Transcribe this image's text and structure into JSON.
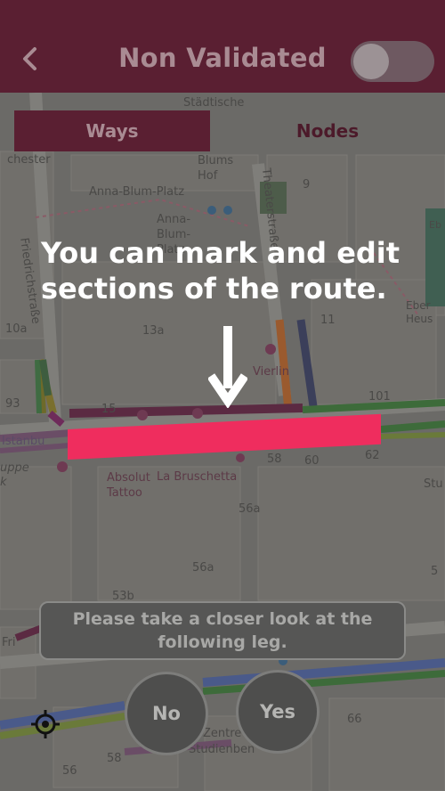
{
  "header": {
    "back_icon": "chevron-left-icon",
    "title": "Non Validated",
    "toggle_on": false
  },
  "tabs": [
    {
      "label": "Ways",
      "active": true
    },
    {
      "label": "Nodes",
      "active": false
    }
  ],
  "map": {
    "labels": {
      "stadtische": "Städtische",
      "chester": "chester",
      "blums_hof": "Blums\nHof",
      "n9": "9",
      "theaterstrasse": "Theaterstraße",
      "anna_blum_platz": "Anna-Blum-Platz",
      "anna_blum": "Anna-\nBlum-\nPlatz",
      "eb": "Eb",
      "friedrichstrasse": "Friedrichstraße",
      "n10a": "10a",
      "n13a": "13a",
      "n11": "11",
      "vierlin": "Vierlin",
      "n101": "101",
      "n93": "93",
      "n15": "15",
      "istanbul": "Istanbu",
      "uppe": "uppe",
      "k": "k",
      "n58": "58",
      "n60": "60",
      "n62": "62",
      "stu": "Stu",
      "absolut_tattoo": "Absolut\nTattoo",
      "la_bruschetta": "La Bruschetta",
      "n56a": "56a",
      "n56a_2": "56a",
      "n53b": "53b",
      "fri": "Fri",
      "n66": "66",
      "n58_2": "58",
      "n56": "56",
      "centre": "Zentre",
      "studienben": "Studienben",
      "n5": "5",
      "eberheu": "Eber\nHeus"
    }
  },
  "tutorial": {
    "text": "You can mark and edit sections of the route.",
    "arrow_icon": "arrow-down-icon"
  },
  "dialog": {
    "prompt": "Please take a closer look at the following leg.",
    "no_label": "No",
    "yes_label": "Yes"
  },
  "locate_icon": "crosshair-icon",
  "colors": {
    "header": "#5a1f32",
    "accent": "#ef2d5e",
    "tab_inactive_text": "#4c1a2a"
  }
}
